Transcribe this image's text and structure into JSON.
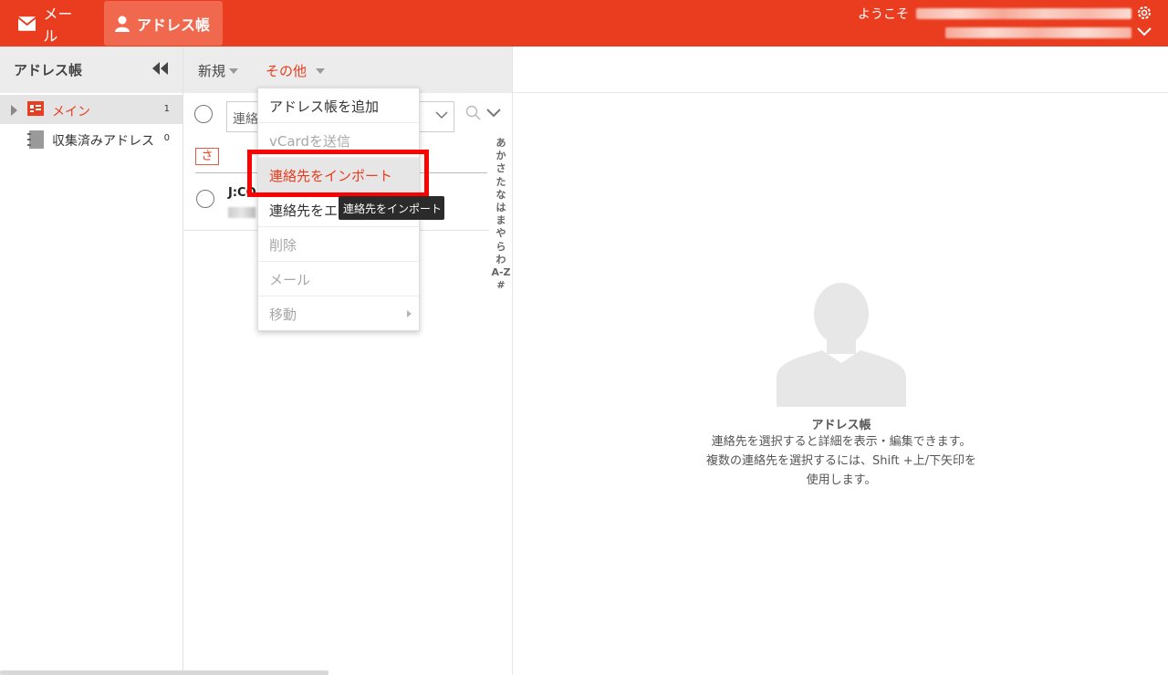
{
  "topbar": {
    "mail_label": "メール",
    "addressbook_label": "アドレス帳",
    "welcome_text": "ようこそ"
  },
  "sidebar": {
    "title": "アドレス帳",
    "items": [
      {
        "label": "メイン",
        "count": "1"
      },
      {
        "label": "収集済みアドレス",
        "count": "0"
      }
    ]
  },
  "toolbar": {
    "new_label": "新規",
    "other_label": "その他"
  },
  "list": {
    "search_placeholder": "連絡",
    "letter_tag": "さ",
    "alpha_index": [
      "あ",
      "か",
      "さ",
      "た",
      "な",
      "は",
      "ま",
      "や",
      "ら",
      "わ",
      "A-Z",
      "#"
    ],
    "contacts": [
      {
        "name": "J:CO"
      }
    ]
  },
  "menu": {
    "items": [
      {
        "label": "アドレス帳を追加",
        "enabled": true
      },
      {
        "label": "vCardを送信",
        "enabled": false
      },
      {
        "label": "連絡先をインポート",
        "enabled": true,
        "highlighted": true
      },
      {
        "label": "連絡先をエ",
        "enabled": true
      },
      {
        "label": "削除",
        "enabled": false
      },
      {
        "label": "メール",
        "enabled": false
      },
      {
        "label": "移動",
        "enabled": false,
        "submenu": true
      }
    ]
  },
  "tooltip": "連絡先をインポート",
  "detail": {
    "title": "アドレス帳",
    "description": "連絡先を選択すると詳細を表示・編集できます。 複数の連絡先を選択するには、Shift +上/下矢印を使用します。"
  },
  "colors": {
    "accent": "#ea3c1f",
    "highlight_box": "#ff0000"
  }
}
